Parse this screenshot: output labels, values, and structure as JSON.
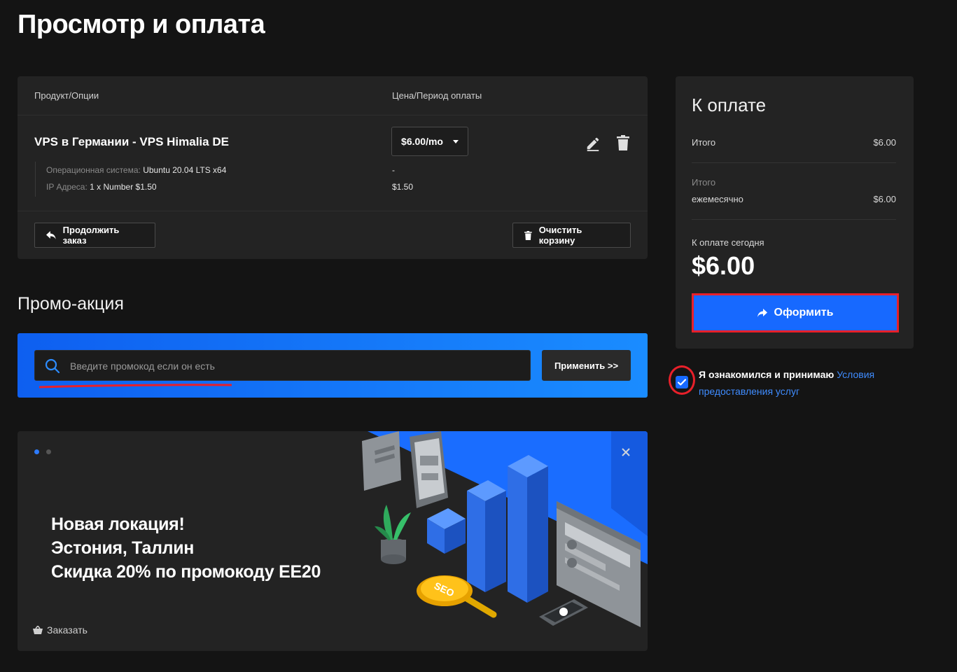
{
  "page": {
    "title": "Просмотр и оплата"
  },
  "cart": {
    "col_product": "Продукт/Опции",
    "col_price": "Цена/Период оплаты",
    "product_name": "VPS в Германии - VPS Himalia DE",
    "price_select": "$6.00/mo",
    "options": [
      {
        "label": "Операционная система:",
        "value": "Ubuntu 20.04 LTS x64",
        "price": "-"
      },
      {
        "label": "IP Адреса:",
        "value": "1 x Number $1.50",
        "price": "$1.50"
      }
    ],
    "continue_label": "Продолжить заказ",
    "clear_label": "Очистить корзину"
  },
  "promo": {
    "title": "Промо-акция",
    "placeholder": "Введите промокод если он есть",
    "apply_label": "Применить >>"
  },
  "banner": {
    "line1": "Новая локация!",
    "line2": "Эстония, Таллин",
    "line3": "Скидка 20% по промокоду EE20",
    "order_label": "Заказать",
    "seo_text": "SEO",
    "accent": "#1a6dff"
  },
  "summary": {
    "title": "К оплате",
    "subtotal_label": "Итого",
    "subtotal_amount": "$6.00",
    "recurring_label_top": "Итого",
    "recurring_label": "ежемесячно",
    "recurring_amount": "$6.00",
    "today_label": "К оплате сегодня",
    "today_amount": "$6.00",
    "checkout_label": "Оформить"
  },
  "tos": {
    "checked": true,
    "text": "Я ознакомился и принимаю",
    "link": "Условия предоставления услуг"
  },
  "colors": {
    "accent": "#1769ff",
    "highlight": "#e8202a",
    "background": "#141414",
    "card": "#232323"
  }
}
